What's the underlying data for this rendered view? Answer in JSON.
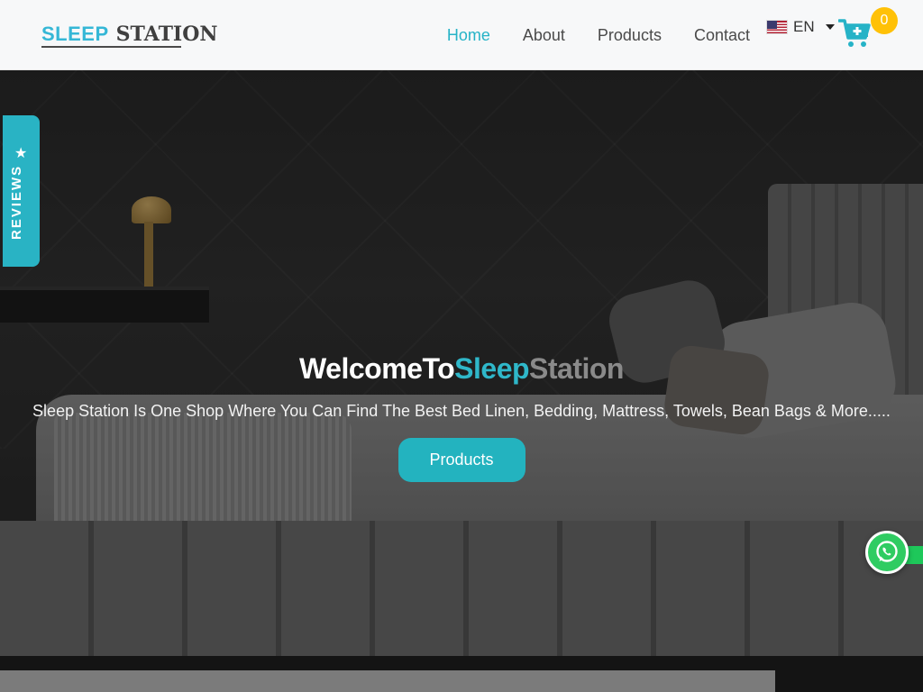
{
  "header": {
    "logo_part1": "SLEEP",
    "logo_part2": "STATION",
    "nav": [
      {
        "label": "Home",
        "active": true
      },
      {
        "label": "About"
      },
      {
        "label": "Products"
      },
      {
        "label": "Contact"
      }
    ],
    "language": {
      "code": "EN",
      "flag": "us-flag-icon"
    },
    "cart": {
      "count": "0",
      "icon": "cart-plus-icon"
    }
  },
  "hero": {
    "title_part1": "WelcomeTo",
    "title_part2": "Sleep",
    "title_part3": "Station",
    "subtitle": "Sleep Station Is One Shop Where You Can Find The Best Bed Linen, Bedding, Mattress, Towels, Bean Bags & More.....",
    "button_label": "Products"
  },
  "reviews_tab": {
    "label": "REVIEWS",
    "icon": "star-icon"
  },
  "whatsapp": {
    "icon": "whatsapp-icon"
  },
  "colors": {
    "accent": "#26b3c7",
    "logo_blue": "#35b7d6",
    "badge": "#ffc107",
    "whatsapp": "#2fcc62"
  }
}
